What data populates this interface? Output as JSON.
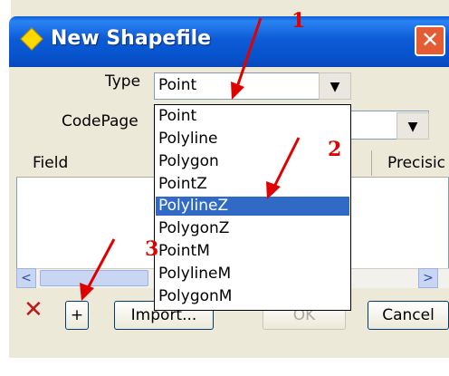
{
  "window": {
    "title": "New Shapefile",
    "close_glyph": "✕"
  },
  "form": {
    "type_label": "Type",
    "type_value": "Point",
    "codepage_label": "CodePage",
    "dropdown_glyph": "▼"
  },
  "grid": {
    "col_field": "Field",
    "col_precision": "Precisic"
  },
  "scroll": {
    "left": "<",
    "right": ">"
  },
  "buttons": {
    "delete": "✕",
    "add": "+",
    "import": "Import...",
    "ok": "OK",
    "cancel": "Cancel"
  },
  "type_options": [
    "Point",
    "Polyline",
    "Polygon",
    "PointZ",
    "PolylineZ",
    "PolygonZ",
    "PointM",
    "PolylineM",
    "PolygonM"
  ],
  "selected_option": "PolylineZ",
  "annotations": {
    "n1": "1",
    "n2": "2",
    "n3": "3"
  },
  "colors": {
    "accent": "#e00000",
    "selection": "#316ac5",
    "titlebar": "#0653cc"
  }
}
